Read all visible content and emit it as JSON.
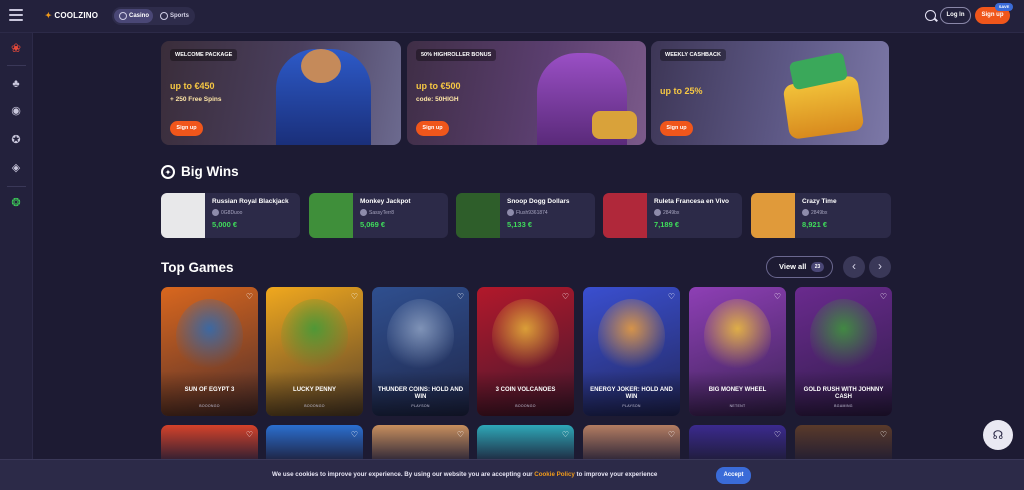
{
  "header": {
    "logo": "COOLZINO",
    "tabs": [
      {
        "label": "Casino"
      },
      {
        "label": "Sports"
      }
    ],
    "login_label": "Log In",
    "signup_label": "Sign up",
    "save_badge": "SAVE"
  },
  "promos": [
    {
      "tag": "WELCOME PACKAGE",
      "amount": "up to €450",
      "sub": "+ 250 Free Spins",
      "button": "Sign up"
    },
    {
      "tag": "50% HIGHROLLER BONUS",
      "amount": "up to €500",
      "sub": "code: 50HIGH",
      "button": "Sign up"
    },
    {
      "tag": "WEEKLY CASHBACK",
      "amount": "up to 25%",
      "sub": "",
      "button": "Sign up"
    }
  ],
  "big_wins": {
    "title": "Big Wins",
    "items": [
      {
        "game": "Russian Royal Blackjack",
        "user": "0G8Duoo",
        "amount": "5,000 €",
        "thumb": "#e8e8ea"
      },
      {
        "game": "Monkey Jackpot",
        "user": "SassyTerr8",
        "amount": "5,069 €",
        "thumb": "#3f8f3a"
      },
      {
        "game": "Snoop Dogg Dollars",
        "user": "Flush9361874",
        "amount": "5,133 €",
        "thumb": "#2e5e2a"
      },
      {
        "game": "Ruleta Francesa en Vivo",
        "user": "2849bx",
        "amount": "7,189 €",
        "thumb": "#b0283a"
      },
      {
        "game": "Crazy Time",
        "user": "2849bx",
        "amount": "8,921 €",
        "thumb": "#e09a3a"
      }
    ]
  },
  "top_games": {
    "title": "Top Games",
    "view_all_label": "View all",
    "view_all_count": "23",
    "items": [
      {
        "name": "SUN OF EGYPT 3",
        "provider": "BOOONGO",
        "bg": "#d9671e",
        "art": "#2a6cb8"
      },
      {
        "name": "LUCKY PENNY",
        "provider": "BOOONGO",
        "bg": "#f0a81e",
        "art": "#3d9b3a"
      },
      {
        "name": "THUNDER COINS: HOLD AND WIN",
        "provider": "PLAYSON",
        "bg": "#2f4f8f",
        "art": "#8ea1c2"
      },
      {
        "name": "3 COIN VOLCANOES",
        "provider": "BOOONGO",
        "bg": "#b2182b",
        "art": "#e8b63a"
      },
      {
        "name": "ENERGY JOKER: HOLD AND WIN",
        "provider": "PLAYSON",
        "bg": "#3a4fd0",
        "art": "#f2a23a"
      },
      {
        "name": "BIG MONEY WHEEL",
        "provider": "NETENT",
        "bg": "#8e3fb5",
        "art": "#f2c33a"
      },
      {
        "name": "GOLD RUSH WITH JOHNNY CASH",
        "provider": "BGAMING",
        "bg": "#6a2a8e",
        "art": "#3e9a3a"
      }
    ],
    "second_row": [
      "#d5422a",
      "#2b6fd0",
      "#c88f5e",
      "#2ea8b8",
      "#b47d62",
      "#3b2a8e",
      "#5a3a2a"
    ]
  },
  "cookie": {
    "text_before": "We use cookies to improve your experience. By using our website you are accepting our ",
    "link": "Cookie Policy",
    "text_after": " to improve your experience",
    "accept_label": "Accept"
  }
}
